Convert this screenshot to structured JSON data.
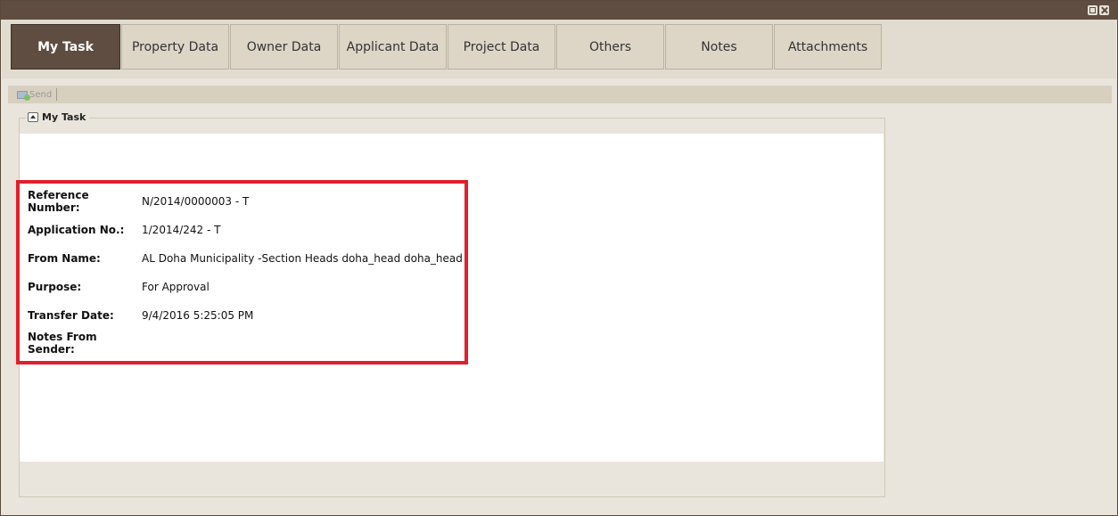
{
  "tabs": [
    {
      "label": "My Task",
      "active": true
    },
    {
      "label": "Property Data",
      "active": false
    },
    {
      "label": "Owner Data",
      "active": false
    },
    {
      "label": "Applicant Data",
      "active": false
    },
    {
      "label": "Project Data",
      "active": false
    },
    {
      "label": "Others",
      "active": false
    },
    {
      "label": "Notes",
      "active": false
    },
    {
      "label": "Attachments",
      "active": false
    }
  ],
  "toolbar": {
    "send_label": "Send",
    "send_icon": "send-mail-icon"
  },
  "task_panel": {
    "title": "My Task",
    "fields": [
      {
        "label": "Reference Number:",
        "value": "N/2014/0000003 - T"
      },
      {
        "label": "Application No.:",
        "value": "1/2014/242 - T"
      },
      {
        "label": "From Name:",
        "value": "AL Doha Municipality -Section Heads doha_head doha_head"
      },
      {
        "label": "Purpose:",
        "value": "For Approval"
      },
      {
        "label": "Transfer Date:",
        "value": "9/4/2016 5:25:05 PM"
      },
      {
        "label": "Notes From Sender:",
        "value": ""
      }
    ]
  },
  "colors": {
    "titlebar": "#5e4d40",
    "active_tab": "#5e4d40",
    "tab_bg": "#ddd6c7",
    "highlight": "#e0202c"
  }
}
